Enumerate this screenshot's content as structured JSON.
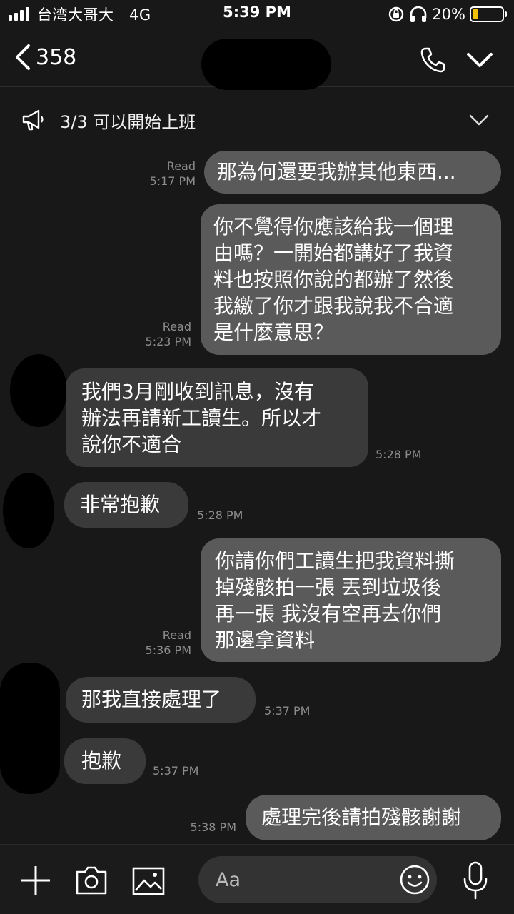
{
  "status_bar": {
    "carrier": "台湾大哥大",
    "network": "4G",
    "time": "5:39 PM",
    "battery_percent": "20%",
    "battery_level": 0.2,
    "battery_color": "#f2c200"
  },
  "header": {
    "back_count": "358",
    "icons": [
      "back-chevron-icon",
      "phone-icon",
      "chevron-down-icon"
    ]
  },
  "announcement": {
    "text": "3/3 可以開始上班",
    "icon": "megaphone-icon"
  },
  "messages": [
    {
      "side": "out",
      "text": "那為何還要我辦其他東西...",
      "read": "Read",
      "time": "5:17 PM"
    },
    {
      "side": "out",
      "text": "你不覺得你應該給我一個理\n由嗎？一開始都講好了我資\n料也按照你說的都辦了然後\n我繳了你才跟我說我不合適\n是什麼意思？",
      "read": "Read",
      "time": "5:23 PM"
    },
    {
      "side": "in",
      "text": "我們3月剛收到訊息，沒有\n辦法再請新工讀生。所以才\n說你不適合",
      "time": "5:28 PM"
    },
    {
      "side": "in",
      "text": "非常抱歉",
      "time": "5:28 PM"
    },
    {
      "side": "out",
      "text": "你請你們工讀生把我資料撕\n掉殘骸拍一張 丟到垃圾後\n再一張 我沒有空再去你們\n那邊拿資料",
      "read": "Read",
      "time": "5:36 PM"
    },
    {
      "side": "in",
      "text": "那我直接處理了",
      "time": "5:37 PM"
    },
    {
      "side": "in",
      "text": "抱歉",
      "time": "5:37 PM"
    },
    {
      "side": "out",
      "text": "處理完後請拍殘骸謝謝",
      "time": "5:38 PM"
    }
  ],
  "input_bar": {
    "placeholder": "Aa",
    "icons": [
      "plus-icon",
      "camera-icon",
      "image-icon",
      "emoji-icon",
      "microphone-icon"
    ]
  },
  "colors": {
    "background": "#181818",
    "outgoing_bubble": "#5a5a5a",
    "incoming_bubble": "#3a3a3a",
    "meta_text": "#8d8d8d"
  }
}
